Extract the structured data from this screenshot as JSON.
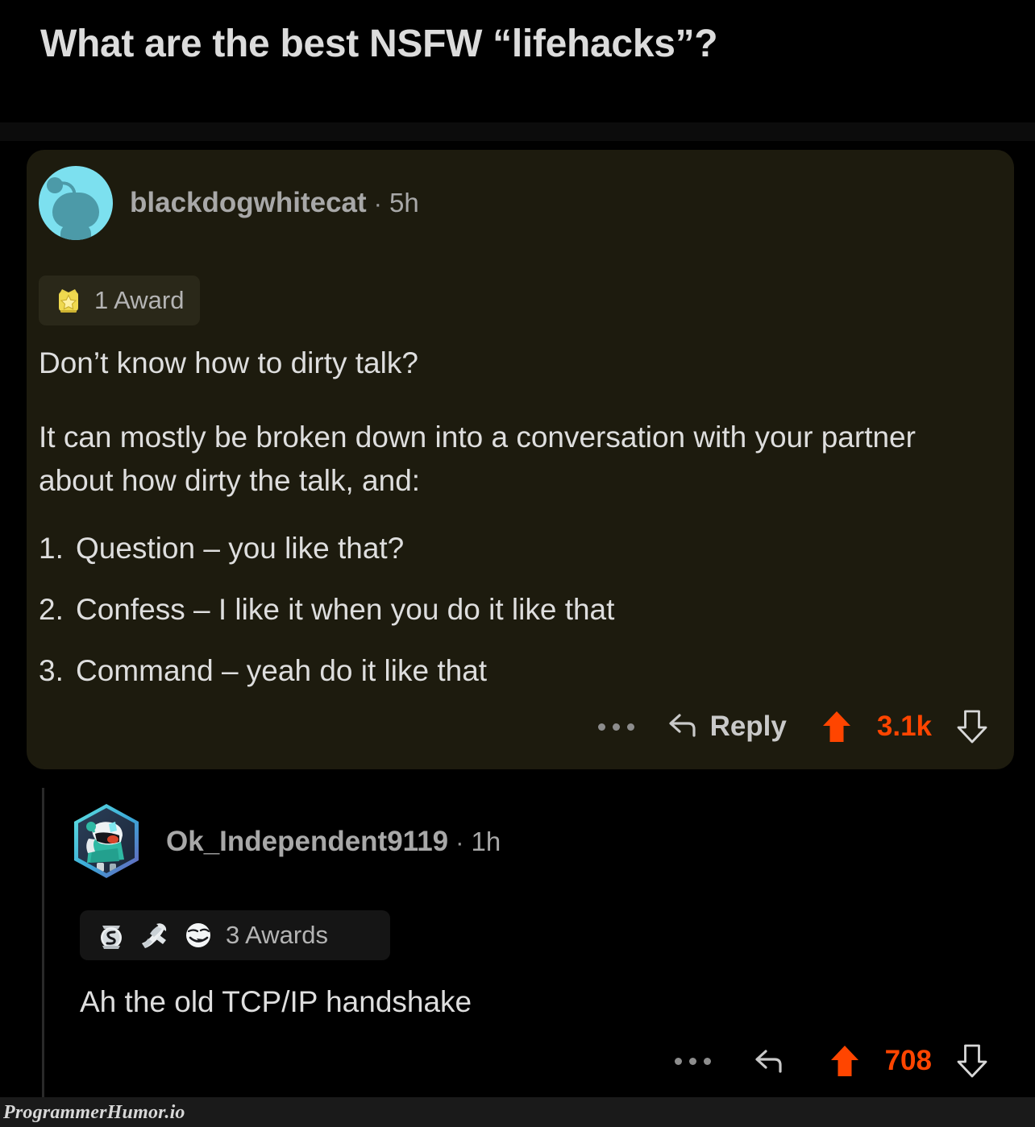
{
  "post": {
    "title": "What are the best NSFW “lifehacks”?"
  },
  "colors": {
    "upvote_orange": "#ff4500",
    "card_background": "#1d1b0e",
    "page_background": "#000000",
    "award_gold": "#ecd54b",
    "avatar_cyan": "#7ce0ef"
  },
  "top_comment": {
    "author": "blackdogwhitecat",
    "separator": "·",
    "timestamp": "5h",
    "avatar_icon": "reddit-snoo-avatar",
    "awards": {
      "label": "1 Award",
      "icons": [
        "gold-star-crown-award-icon"
      ]
    },
    "paragraphs": [
      "Don’t know how to dirty talk?",
      "It can mostly be broken down into a conversation with your partner about how dirty the talk, and:"
    ],
    "list": [
      {
        "num": "1.",
        "text": "Question – you like that?"
      },
      {
        "num": "2.",
        "text": "Confess – I like it when you do it like that"
      },
      {
        "num": "3.",
        "text": "Command – yeah do it like that"
      }
    ],
    "actions": {
      "more_icon": "kebab-more-icon",
      "reply_icon": "reply-arrow-icon",
      "reply_label": "Reply",
      "upvote_icon": "upvote-arrow-icon",
      "score": "3.1k",
      "downvote_icon": "downvote-arrow-icon"
    }
  },
  "reply_comment": {
    "author": "Ok_Independent9119",
    "separator": "·",
    "timestamp": "1h",
    "avatar_icon": "hexagon-nft-robot-avatar",
    "awards": {
      "label": "3 Awards",
      "icons": [
        "silver-coin-award-icon",
        "handshake-award-icon",
        "smiling-face-award-icon"
      ]
    },
    "text": "Ah the old TCP/IP handshake",
    "actions": {
      "more_icon": "kebab-more-icon",
      "reply_icon": "reply-arrow-icon",
      "upvote_icon": "upvote-arrow-icon",
      "score": "708",
      "downvote_icon": "downvote-arrow-icon"
    }
  },
  "watermark": {
    "text": "ProgrammerHumor.io"
  }
}
